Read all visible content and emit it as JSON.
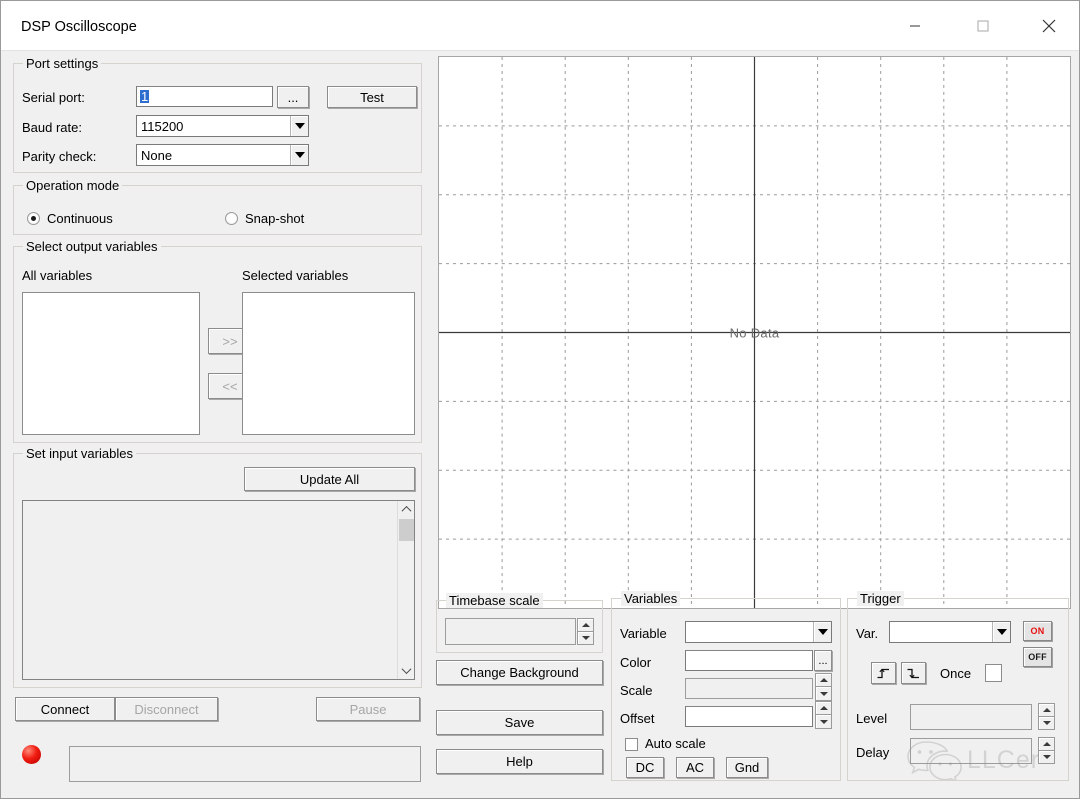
{
  "window": {
    "title": "DSP Oscilloscope",
    "minimize_label": "Minimize",
    "maximize_label": "Maximize",
    "close_label": "Close"
  },
  "port_settings": {
    "group_title": "Port settings",
    "serial_port_label": "Serial port:",
    "serial_port_value": "1",
    "browse_label": "...",
    "test_label": "Test",
    "baud_rate_label": "Baud rate:",
    "baud_rate_value": "115200",
    "parity_check_label": "Parity check:",
    "parity_check_value": "None"
  },
  "operation_mode": {
    "group_title": "Operation mode",
    "options": [
      {
        "label": "Continuous",
        "selected": true
      },
      {
        "label": "Snap-shot",
        "selected": false
      }
    ]
  },
  "output_variables": {
    "group_title": "Select output variables",
    "all_label": "All variables",
    "selected_label": "Selected variables",
    "add_label": ">>",
    "remove_label": "<<",
    "all_items": [],
    "selected_items": []
  },
  "input_variables": {
    "group_title": "Set input variables",
    "update_all_label": "Update All",
    "items": []
  },
  "connection": {
    "connect_label": "Connect",
    "disconnect_label": "Disconnect",
    "pause_label": "Pause",
    "status_text": "",
    "led_color": "#f01b10"
  },
  "scope": {
    "empty_message": "No Data",
    "background_color": "#ffffff",
    "grid_color": "#9a9a9a",
    "axis_color": "#3a3a3a"
  },
  "chart_data": {
    "type": "line",
    "title": "",
    "xlabel": "",
    "ylabel": "",
    "series": [],
    "annotations": [
      "No Data"
    ],
    "grid": true,
    "grid_columns": 10,
    "grid_rows": 8,
    "center_axes": true,
    "legend_position": "none"
  },
  "timebase": {
    "group_title": "Timebase scale",
    "value": "",
    "change_background_label": "Change Background",
    "save_label": "Save",
    "help_label": "Help"
  },
  "variables_panel": {
    "group_title": "Variables",
    "variable_label": "Variable",
    "variable_value": "",
    "color_label": "Color",
    "color_value": "",
    "color_browse_label": "...",
    "scale_label": "Scale",
    "scale_value": "",
    "offset_label": "Offset",
    "offset_value": "",
    "auto_scale_label": "Auto scale",
    "auto_scale_checked": false,
    "coupling": [
      {
        "label": "DC"
      },
      {
        "label": "AC"
      },
      {
        "label": "Gnd"
      }
    ]
  },
  "trigger": {
    "group_title": "Trigger",
    "var_label": "Var.",
    "var_value": "",
    "on_label": "ON",
    "off_label": "OFF",
    "rising_edge_label": "Rising edge",
    "falling_edge_label": "Falling edge",
    "once_label": "Once",
    "once_checked": false,
    "level_label": "Level",
    "level_value": "",
    "delay_label": "Delay",
    "delay_value": ""
  },
  "watermark": {
    "text": "LLCer"
  }
}
